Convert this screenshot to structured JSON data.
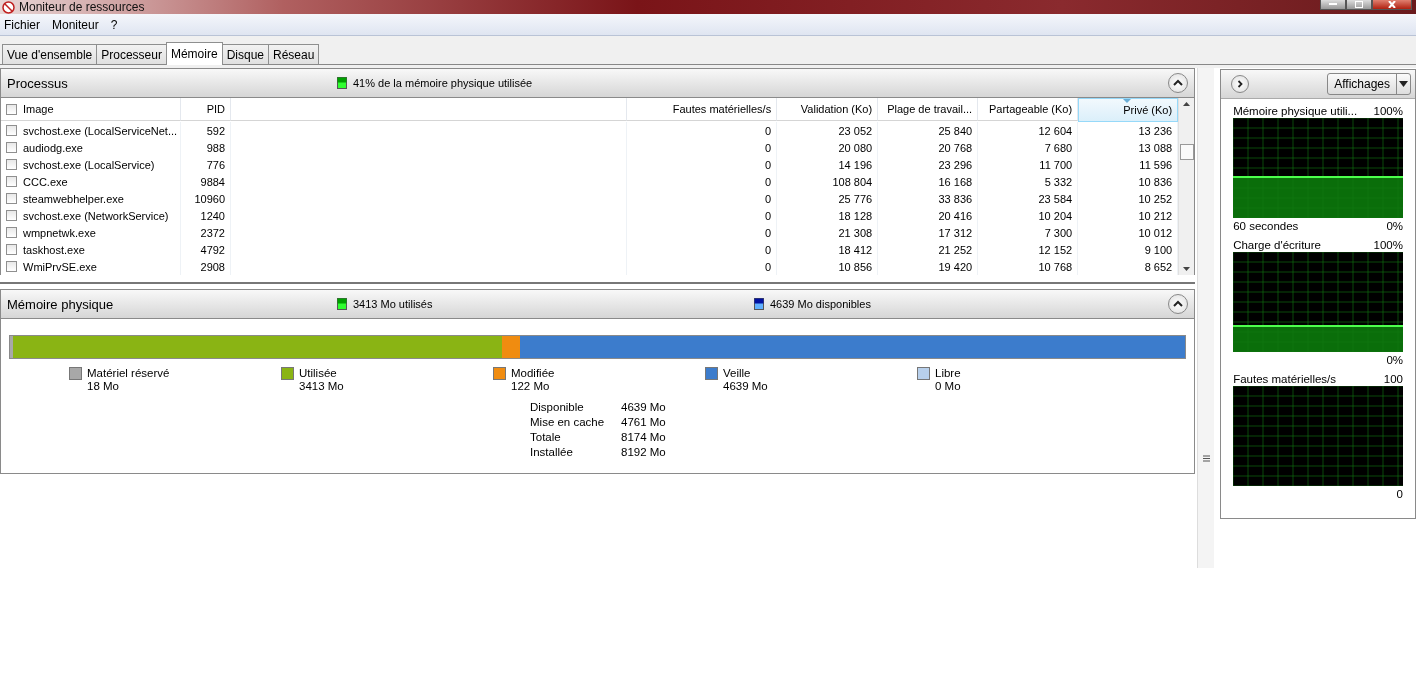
{
  "window": {
    "title": "Moniteur de ressources"
  },
  "menu": [
    "Fichier",
    "Moniteur",
    "?"
  ],
  "tabs": [
    {
      "label": "Vue d'ensemble",
      "selected": false
    },
    {
      "label": "Processeur",
      "selected": false
    },
    {
      "label": "Mémoire",
      "selected": true
    },
    {
      "label": "Disque",
      "selected": false
    },
    {
      "label": "Réseau",
      "selected": false
    }
  ],
  "processes": {
    "title": "Processus",
    "summary": "41% de la mémoire physique utilisée",
    "expanded": true,
    "columns": [
      {
        "label": "Image",
        "sorted": false
      },
      {
        "label": "PID",
        "sorted": false
      },
      {
        "label": "Fautes matérielles/s",
        "sorted": false
      },
      {
        "label": "Validation (Ko)",
        "sorted": false
      },
      {
        "label": "Plage de travail...",
        "sorted": false
      },
      {
        "label": "Partageable (Ko)",
        "sorted": false
      },
      {
        "label": "Privé (Ko)",
        "sorted": true
      }
    ],
    "all_checked": false,
    "rows": [
      {
        "checked": false,
        "cells": [
          "svchost.exe (LocalServiceNet...",
          "592",
          "0",
          "23 052",
          "25 840",
          "12 604",
          "13 236"
        ]
      },
      {
        "checked": false,
        "cells": [
          "audiodg.exe",
          "988",
          "0",
          "20 080",
          "20 768",
          "7 680",
          "13 088"
        ]
      },
      {
        "checked": false,
        "cells": [
          "svchost.exe (LocalService)",
          "776",
          "0",
          "14 196",
          "23 296",
          "11 700",
          "11 596"
        ]
      },
      {
        "checked": false,
        "cells": [
          "CCC.exe",
          "9884",
          "0",
          "108 804",
          "16 168",
          "5 332",
          "10 836"
        ]
      },
      {
        "checked": false,
        "cells": [
          "steamwebhelper.exe",
          "10960",
          "0",
          "25 776",
          "33 836",
          "23 584",
          "10 252"
        ]
      },
      {
        "checked": false,
        "cells": [
          "svchost.exe (NetworkService)",
          "1240",
          "0",
          "18 128",
          "20 416",
          "10 204",
          "10 212"
        ]
      },
      {
        "checked": false,
        "cells": [
          "wmpnetwk.exe",
          "2372",
          "0",
          "21 308",
          "17 312",
          "7 300",
          "10 012"
        ]
      },
      {
        "checked": false,
        "cells": [
          "taskhost.exe",
          "4792",
          "0",
          "18 412",
          "21 252",
          "12 152",
          "9 100"
        ]
      },
      {
        "checked": false,
        "cells": [
          "WmiPrvSE.exe",
          "2908",
          "0",
          "10 856",
          "19 420",
          "10 768",
          "8 652"
        ]
      }
    ]
  },
  "physical_memory": {
    "title": "Mémoire physique",
    "used_summary": "3413 Mo utilisés",
    "available_summary": "4639 Mo disponibles",
    "expanded": true,
    "segments": [
      {
        "label": "Matériel réservé",
        "value": "18 Mo",
        "color": "#a8a8a8",
        "level": 0.0022
      },
      {
        "label": "Utilisée",
        "value": "3413 Mo",
        "color": "#8ab414",
        "level": 0.4166
      },
      {
        "label": "Modifiée",
        "value": "122 Mo",
        "color": "#f08c10",
        "level": 0.0149
      },
      {
        "label": "Veille",
        "value": "4639 Mo",
        "color": "#3c7ccc",
        "level": 0.5663
      },
      {
        "label": "Libre",
        "value": "0 Mo",
        "color": "#b8d0ec"
      }
    ],
    "stats": [
      {
        "label": "Disponible",
        "value": "4639 Mo"
      },
      {
        "label": "Mise en cache",
        "value": "4761 Mo"
      },
      {
        "label": "Totale",
        "value": "8174 Mo"
      },
      {
        "label": "Installée",
        "value": "8192 Mo"
      }
    ]
  },
  "side_panel": {
    "views_button": "Affichages",
    "graphs": [
      {
        "title": "Mémoire physique utili...",
        "max": "100%",
        "time": "60 secondes",
        "min": "0%"
      },
      {
        "title": "Charge d'écriture",
        "max": "100%",
        "min": "0%"
      },
      {
        "title": "Fautes matérielles/s",
        "max": "100",
        "min": "0"
      }
    ]
  }
}
